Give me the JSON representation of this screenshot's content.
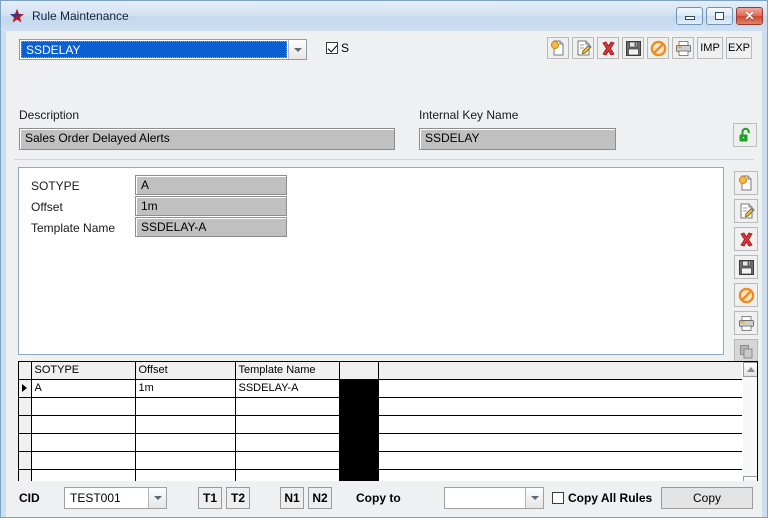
{
  "window": {
    "title": "Rule Maintenance",
    "app_icon": "star-icon",
    "minimize_label": "Minimize",
    "maximize_label": "Maximize",
    "close_label": "✕"
  },
  "header": {
    "rule_combo_value": "SSDELAY",
    "s_checkbox_label": "S",
    "s_checkbox_checked": true,
    "description_label": "Description",
    "description_value": "Sales Order Delayed Alerts",
    "internal_key_label": "Internal Key Name",
    "internal_key_value": "SSDELAY",
    "lock_icon": "unlock-icon"
  },
  "toolbar": {
    "buttons": [
      {
        "name": "new-button",
        "icon": "new-document-icon"
      },
      {
        "name": "edit-button",
        "icon": "edit-pencil-icon"
      },
      {
        "name": "delete-button",
        "icon": "delete-x-icon"
      },
      {
        "name": "save-button",
        "icon": "floppy-disk-icon"
      },
      {
        "name": "cancel-button",
        "icon": "cancel-prohibition-icon"
      },
      {
        "name": "print-button",
        "icon": "printer-icon"
      }
    ],
    "import_label": "IMP",
    "export_label": "EXP"
  },
  "detail_toolbar": {
    "buttons": [
      {
        "name": "detail-new-button",
        "icon": "new-document-icon"
      },
      {
        "name": "detail-edit-button",
        "icon": "edit-pencil-icon"
      },
      {
        "name": "detail-delete-button",
        "icon": "delete-x-icon"
      },
      {
        "name": "detail-save-button",
        "icon": "floppy-disk-icon"
      },
      {
        "name": "detail-cancel-button",
        "icon": "cancel-prohibition-icon"
      },
      {
        "name": "detail-print-button",
        "icon": "printer-icon"
      },
      {
        "name": "detail-copy-button",
        "icon": "copy-icon",
        "disabled": true
      }
    ]
  },
  "detail": {
    "fields": [
      {
        "label": "SOTYPE",
        "value": "A"
      },
      {
        "label": "Offset",
        "value": "1m"
      },
      {
        "label": "Template Name",
        "value": "SSDELAY-A"
      }
    ]
  },
  "grid": {
    "columns": [
      "SOTYPE",
      "Offset",
      "Template Name"
    ],
    "rows": [
      {
        "marker": true,
        "cells": [
          "A",
          "1m",
          "SSDELAY-A"
        ]
      },
      {
        "marker": false,
        "cells": [
          "",
          "",
          ""
        ]
      },
      {
        "marker": false,
        "cells": [
          "",
          "",
          ""
        ]
      },
      {
        "marker": false,
        "cells": [
          "",
          "",
          ""
        ]
      },
      {
        "marker": false,
        "cells": [
          "",
          "",
          ""
        ]
      },
      {
        "marker": false,
        "cells": [
          "",
          "",
          ""
        ]
      },
      {
        "marker": false,
        "cells": [
          "",
          "",
          ""
        ]
      }
    ]
  },
  "footer": {
    "cid_label": "CID",
    "cid_value": "TEST001",
    "t1_label": "T1",
    "t2_label": "T2",
    "n1_label": "N1",
    "n2_label": "N2",
    "copy_to_label": "Copy to",
    "copy_to_value": "",
    "copy_all_rules_label": "Copy All Rules",
    "copy_all_rules_checked": false,
    "copy_button_label": "Copy"
  },
  "colors": {
    "titlebar": "#cfe0f2",
    "window_border": "#7ea3c4",
    "client_bg": "#eff0f1",
    "selection_blue": "#0a60d2",
    "field_gray": "#c0c0c0",
    "close_red": "#cc4730",
    "lock_green": "#1e9e22"
  }
}
